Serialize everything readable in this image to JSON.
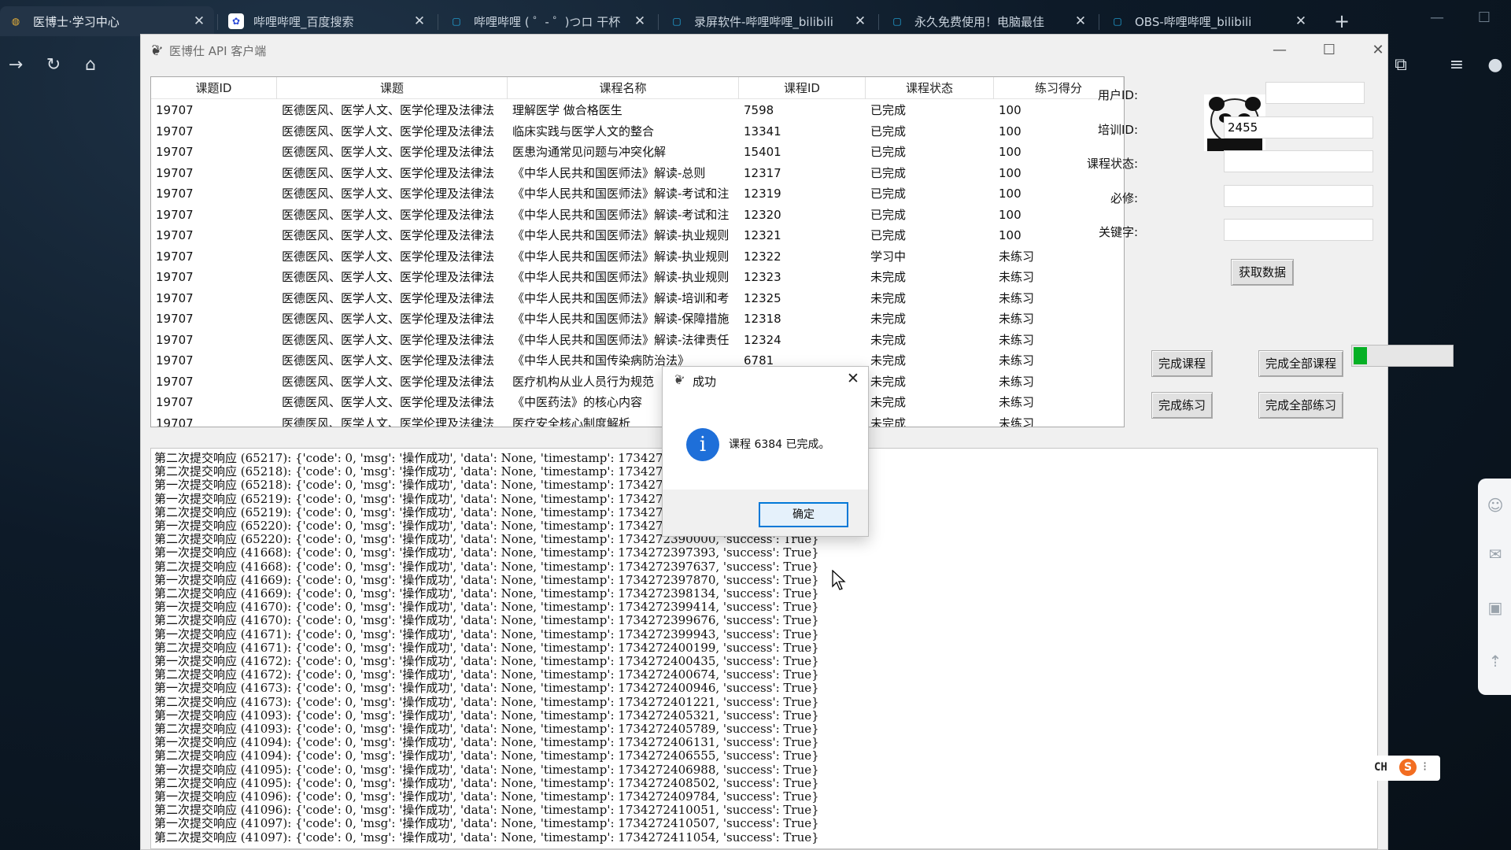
{
  "browser": {
    "tabs": [
      {
        "title": "医博士·学习中心",
        "icon": "globe-icon",
        "active": true
      },
      {
        "title": "哔哩哔哩_百度搜索",
        "icon": "baidu-paw-icon",
        "active": false
      },
      {
        "title": "哔哩哔哩 ( ゜- ゜)つロ 干杯",
        "icon": "bilibili-tv-icon",
        "active": false
      },
      {
        "title": "录屏软件-哔哩哔哩_bilibili",
        "icon": "bilibili-tv-icon",
        "active": false
      },
      {
        "title": "永久免费使用！电脑最佳",
        "icon": "bilibili-tv-icon",
        "active": false
      },
      {
        "title": "OBS-哔哩哔哩_bilibili",
        "icon": "bilibili-tv-icon",
        "active": false
      }
    ],
    "new_tab": "+",
    "accent": "#0078d7"
  },
  "app": {
    "title": "医博仕 API 客户端",
    "columns": [
      "课题ID",
      "课题",
      "课程名称",
      "课程ID",
      "课程状态",
      "练习得分"
    ],
    "rows": [
      [
        "19707",
        "医德医风、医学人文、医学伦理及法律法",
        "理解医学 做合格医生",
        "7598",
        "已完成",
        "100"
      ],
      [
        "19707",
        "医德医风、医学人文、医学伦理及法律法",
        "临床实践与医学人文的整合",
        "13341",
        "已完成",
        "100"
      ],
      [
        "19707",
        "医德医风、医学人文、医学伦理及法律法",
        "医患沟通常见问题与冲突化解",
        "15401",
        "已完成",
        "100"
      ],
      [
        "19707",
        "医德医风、医学人文、医学伦理及法律法",
        "《中华人民共和国医师法》解读-总则",
        "12317",
        "已完成",
        "100"
      ],
      [
        "19707",
        "医德医风、医学人文、医学伦理及法律法",
        "《中华人民共和国医师法》解读-考试和注",
        "12319",
        "已完成",
        "100"
      ],
      [
        "19707",
        "医德医风、医学人文、医学伦理及法律法",
        "《中华人民共和国医师法》解读-考试和注",
        "12320",
        "已完成",
        "100"
      ],
      [
        "19707",
        "医德医风、医学人文、医学伦理及法律法",
        "《中华人民共和国医师法》解读-执业规则",
        "12321",
        "已完成",
        "100"
      ],
      [
        "19707",
        "医德医风、医学人文、医学伦理及法律法",
        "《中华人民共和国医师法》解读-执业规则",
        "12322",
        "学习中",
        "未练习"
      ],
      [
        "19707",
        "医德医风、医学人文、医学伦理及法律法",
        "《中华人民共和国医师法》解读-执业规则",
        "12323",
        "未完成",
        "未练习"
      ],
      [
        "19707",
        "医德医风、医学人文、医学伦理及法律法",
        "《中华人民共和国医师法》解读-培训和考",
        "12325",
        "未完成",
        "未练习"
      ],
      [
        "19707",
        "医德医风、医学人文、医学伦理及法律法",
        "《中华人民共和国医师法》解读-保障措施",
        "12318",
        "未完成",
        "未练习"
      ],
      [
        "19707",
        "医德医风、医学人文、医学伦理及法律法",
        "《中华人民共和国医师法》解读-法律责任",
        "12324",
        "未完成",
        "未练习"
      ],
      [
        "19707",
        "医德医风、医学人文、医学伦理及法律法",
        "《中华人民共和国传染病防治法》",
        "6781",
        "未完成",
        "未练习"
      ],
      [
        "19707",
        "医德医风、医学人文、医学伦理及法律法",
        "医疗机构从业人员行为规范",
        "",
        "未完成",
        "未练习"
      ],
      [
        "19707",
        "医德医风、医学人文、医学伦理及法律法",
        "《中医药法》的核心内容",
        "",
        "未完成",
        "未练习"
      ],
      [
        "19707",
        "医德医风、医学人文、医学伦理及法律法",
        "医疗安全核心制度解析",
        "",
        "未完成",
        "未练习"
      ]
    ],
    "form": {
      "user_id_label": "用户ID:",
      "user_id_value": "",
      "training_id_label": "培训ID:",
      "training_id_value": "2455",
      "status_label": "课程状态:",
      "status_value": "",
      "required_label": "必修:",
      "required_value": "",
      "keyword_label": "关键字:",
      "keyword_value": ""
    },
    "buttons": {
      "fetch": "获取数据",
      "complete_course": "完成课程",
      "complete_all_courses": "完成全部课程",
      "complete_exercise": "完成练习",
      "complete_all_exercises": "完成全部练习"
    },
    "progress": {
      "fraction": 0.14,
      "color": "#06b025"
    },
    "log": {
      "lines": [
        {
          "prefix": "第二次提交响应",
          "id": "65217",
          "timestamp": ""
        },
        {
          "prefix": "第二次提交响应",
          "id": "65218",
          "timestamp": ""
        },
        {
          "prefix": "第一次提交响应",
          "id": "65218",
          "timestamp": ""
        },
        {
          "prefix": "第一次提交响应",
          "id": "65219",
          "timestamp": ""
        },
        {
          "prefix": "第二次提交响应",
          "id": "65219",
          "timestamp": ""
        },
        {
          "prefix": "第一次提交响应",
          "id": "65220",
          "timestamp": ""
        },
        {
          "prefix": "第二次提交响应",
          "id": "65220",
          "timestamp": ""
        },
        {
          "prefix": "第一次提交响应",
          "id": "41668",
          "timestamp": "1734272397393"
        },
        {
          "prefix": "第二次提交响应",
          "id": "41668",
          "timestamp": "1734272397637"
        },
        {
          "prefix": "第一次提交响应",
          "id": "41669",
          "timestamp": "1734272397870"
        },
        {
          "prefix": "第二次提交响应",
          "id": "41669",
          "timestamp": "1734272398134"
        },
        {
          "prefix": "第一次提交响应",
          "id": "41670",
          "timestamp": "1734272399414"
        },
        {
          "prefix": "第二次提交响应",
          "id": "41670",
          "timestamp": "1734272399676"
        },
        {
          "prefix": "第一次提交响应",
          "id": "41671",
          "timestamp": "1734272399943"
        },
        {
          "prefix": "第二次提交响应",
          "id": "41671",
          "timestamp": "1734272400199"
        },
        {
          "prefix": "第一次提交响应",
          "id": "41672",
          "timestamp": "1734272400435"
        },
        {
          "prefix": "第二次提交响应",
          "id": "41672",
          "timestamp": "1734272400674"
        },
        {
          "prefix": "第一次提交响应",
          "id": "41673",
          "timestamp": "1734272400946"
        },
        {
          "prefix": "第二次提交响应",
          "id": "41673",
          "timestamp": "1734272401221"
        },
        {
          "prefix": "第一次提交响应",
          "id": "41093",
          "timestamp": "1734272405321"
        },
        {
          "prefix": "第二次提交响应",
          "id": "41093",
          "timestamp": "1734272405789"
        },
        {
          "prefix": "第一次提交响应",
          "id": "41094",
          "timestamp": "1734272406131"
        },
        {
          "prefix": "第二次提交响应",
          "id": "41094",
          "timestamp": "1734272406555"
        },
        {
          "prefix": "第一次提交响应",
          "id": "41095",
          "timestamp": "1734272406988"
        },
        {
          "prefix": "第二次提交响应",
          "id": "41095",
          "timestamp": "1734272408502"
        },
        {
          "prefix": "第一次提交响应",
          "id": "41096",
          "timestamp": "1734272409784"
        },
        {
          "prefix": "第二次提交响应",
          "id": "41096",
          "timestamp": "1734272410051"
        },
        {
          "prefix": "第一次提交响应",
          "id": "41097",
          "timestamp": "1734272410507"
        },
        {
          "prefix": "第二次提交响应",
          "id": "41097",
          "timestamp": "1734272411054"
        }
      ]
    }
  },
  "dialog": {
    "title": "成功",
    "message": "课程 6384 已完成。",
    "ok": "确定",
    "icon_letter": "i"
  },
  "ime": {
    "lang": "CH",
    "logo": "S"
  }
}
